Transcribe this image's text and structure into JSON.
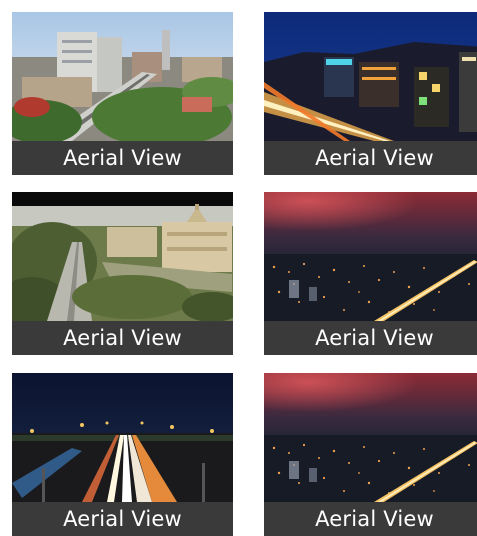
{
  "gallery": {
    "tiles": [
      {
        "caption": "Aerial View",
        "scene": "daytime-city-skyline"
      },
      {
        "caption": "Aerial View",
        "scene": "night-city-street-light-trails"
      },
      {
        "caption": "Aerial View",
        "scene": "daytime-government-building-boulevard"
      },
      {
        "caption": "Aerial View",
        "scene": "dusk-city-lights-panorama"
      },
      {
        "caption": "Aerial View",
        "scene": "night-highway-light-trails"
      },
      {
        "caption": "Aerial View",
        "scene": "dusk-city-lights-panorama"
      }
    ]
  },
  "colors": {
    "caption_background": "#3a3a3a",
    "caption_text": "#ffffff"
  }
}
